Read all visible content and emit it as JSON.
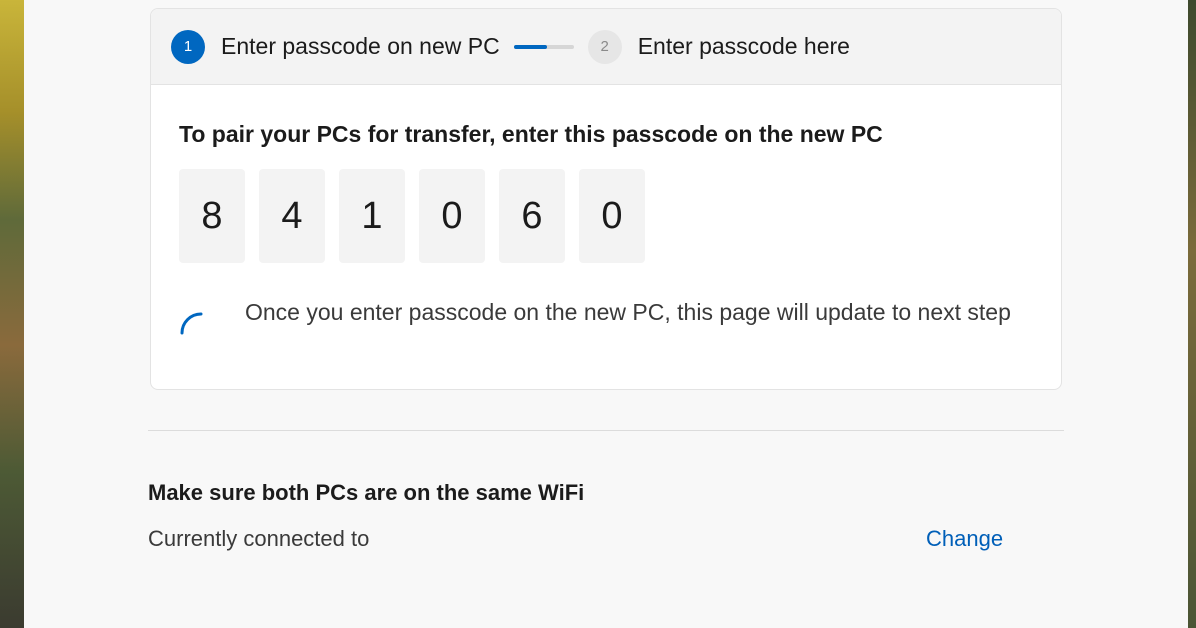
{
  "stepper": {
    "step1": {
      "number": "1",
      "label": "Enter passcode on new PC"
    },
    "step2": {
      "number": "2",
      "label": "Enter passcode here"
    }
  },
  "pairing": {
    "instruction": "To pair your PCs for transfer, enter this passcode on the new PC",
    "passcode": [
      "8",
      "4",
      "1",
      "0",
      "6",
      "0"
    ],
    "wait_message": "Once you enter passcode on the new PC, this page will update to next step"
  },
  "wifi": {
    "title": "Make sure both PCs are on the same WiFi",
    "status": "Currently connected to",
    "change_label": "Change"
  },
  "colors": {
    "accent": "#0067c0",
    "link": "#005fb8"
  }
}
